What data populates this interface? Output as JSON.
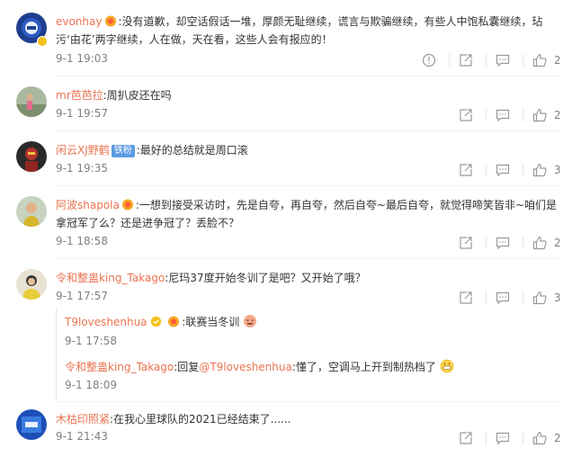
{
  "comments": [
    {
      "username": "evonhay",
      "text_line1": ":没有道歉，却空话假话一堆，厚颜无耻继续，谎言与欺骗继续，有些人中饱私囊继续，玷",
      "text_line2": "污‘由花’两字继续，人在做，天在看，这些人会有报应的！",
      "time": "9-1 19:03",
      "likes": "2"
    },
    {
      "username": "mr芭芭拉",
      "text": ":周扒皮还在吗",
      "time": "9-1 19:57",
      "likes": "2"
    },
    {
      "username": "闲云XJ野鹤",
      "tag": "铁粉",
      "text": ":最好的总结就是周口滚",
      "time": "9-1 19:35",
      "likes": "3"
    },
    {
      "username": "阿波shapola",
      "text_line1": ":一想到接受采访时，先是自夸，再自夸，然后自夸~最后自夸，就觉得啼笑皆非~咱们是",
      "text_line2": "拿冠军了么？还是进争冠了？丢脸不？",
      "time": "9-1 18:58",
      "likes": "2"
    },
    {
      "username": "令和整蛊king_Takago",
      "text": ":尼玛37度开始冬训了是吧？又开始了哦？",
      "time": "9-1 17:57",
      "likes": "3"
    },
    {
      "username": "木枯印照紧",
      "text": ":在我心里球队的2021已经结束了......",
      "time": "9-1 21:43",
      "likes": "2"
    }
  ],
  "replies": [
    {
      "username": "T9loveshenhua",
      "text": ":联赛当冬训",
      "time": "9-1 17:58"
    },
    {
      "username": "令和整蛊king_Takago",
      "prefix": ":回复",
      "mention": "@T9loveshenhua",
      "text": ":懂了，空调马上开到制热档了",
      "time": "9-1 18:09"
    }
  ],
  "colors": {
    "username": "#eb7350",
    "text": "#333333",
    "time": "#808080",
    "icon": "#9a9a9a"
  },
  "icons": {
    "report": "report-icon",
    "forward": "forward-icon",
    "comment": "comment-icon",
    "like": "thumbs-up-icon"
  }
}
